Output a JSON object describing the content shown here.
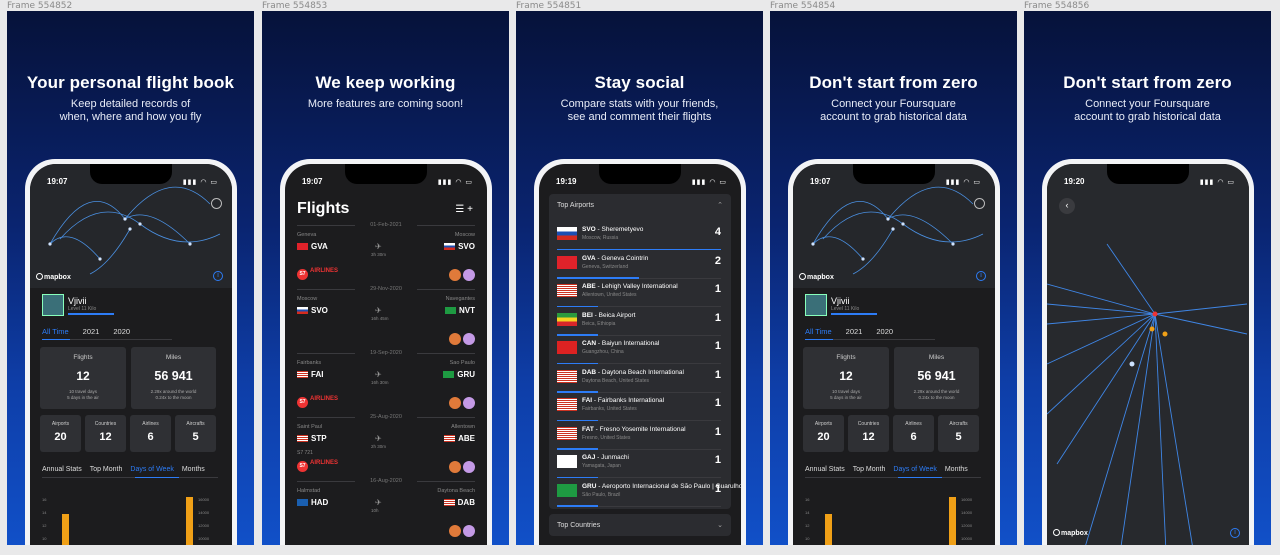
{
  "frames": [
    {
      "label": "Frame 554852",
      "title": "Your personal flight book",
      "subtitle1": "Keep detailed records of",
      "subtitle2": "when, where and how you fly",
      "time": "19:07"
    },
    {
      "label": "Frame 554853",
      "title": "We keep working",
      "subtitle1": "More features are coming soon!",
      "subtitle2": "",
      "time": "19:07"
    },
    {
      "label": "Frame 554851",
      "title": "Stay social",
      "subtitle1": "Compare stats with your friends,",
      "subtitle2": "see and comment their flights",
      "time": "19:19"
    },
    {
      "label": "Frame 554854",
      "title": "Don't start from zero",
      "subtitle1": "Connect your Foursquare",
      "subtitle2": "account to grab historical data",
      "time": "19:07"
    },
    {
      "label": "Frame 554856",
      "title": "Don't start from zero",
      "subtitle1": "Connect your Foursquare",
      "subtitle2": "account to grab historical data",
      "time": "19:20"
    }
  ],
  "mapbox": "mapbox",
  "profile": {
    "name": "Vjivii",
    "level": "Level 11 Kilo",
    "year_tabs": [
      "All Time",
      "2021",
      "2020"
    ],
    "flights_label": "Flights",
    "flights_value": "12",
    "flights_sub1": "10 travel days",
    "flights_sub2": "5 days in the air",
    "miles_label": "Miles",
    "miles_value": "56 941",
    "miles_sub1": "2.29x around the world",
    "miles_sub2": "0.24x to the moon",
    "airports_label": "Airports",
    "airports_value": "20",
    "countries_label": "Countries",
    "countries_value": "12",
    "airlines_label": "Airlines",
    "airlines_value": "6",
    "aircrafts_label": "Aircrafts",
    "aircrafts_value": "5",
    "stat_tabs": [
      "Annual Stats",
      "Top Month",
      "Days of Week",
      "Months"
    ],
    "axis_left": [
      "16",
      "14",
      "12",
      "10"
    ],
    "axis_right": [
      "16000",
      "14000",
      "12000",
      "10000"
    ]
  },
  "flights_screen": {
    "title": "Flights",
    "filter_icon": "filter-icon",
    "add_icon": "plus-icon",
    "dates": [
      "01-Feb-2021",
      "29-Nov-2020",
      "19-Sep-2020",
      "25-Aug-2020",
      "16-Aug-2020"
    ],
    "items": [
      {
        "from_city": "Geneva",
        "from": "GVA",
        "to_city": "Moscow",
        "to": "SVO",
        "duration": "3h 30m",
        "number": "",
        "airline": "AIRLINES"
      },
      {
        "from_city": "Moscow",
        "from": "SVO",
        "to_city": "Navegantes",
        "to": "NVT",
        "duration": "16h 45m",
        "number": "",
        "airline": ""
      },
      {
        "from_city": "Fairbanks",
        "from": "FAI",
        "to_city": "Sao Paulo",
        "to": "GRU",
        "duration": "16h 30m",
        "number": "",
        "airline": "AIRLINES"
      },
      {
        "from_city": "Saint Paul",
        "from": "STP",
        "to_city": "Allentown",
        "to": "ABE",
        "duration": "2h 30m",
        "number": "S7 721",
        "airline": "AIRLINES"
      },
      {
        "from_city": "Halmstad",
        "from": "HAD",
        "to_city": "Daytona Beach",
        "to": "DAB",
        "duration": "10h",
        "number": "",
        "airline": ""
      }
    ]
  },
  "airports_screen": {
    "header": "Top Airports",
    "footer": "Top Countries",
    "rows": [
      {
        "code": "SVO",
        "name": "Sheremetyevo",
        "loc": "Moscow, Russia",
        "count": "4",
        "flag": "f-ru",
        "bar": 100
      },
      {
        "code": "GVA",
        "name": "Geneva Cointrin",
        "loc": "Geneva, Switzerland",
        "count": "2",
        "flag": "f-ch",
        "bar": 50
      },
      {
        "code": "ABE",
        "name": "Lehigh Valley International",
        "loc": "Allentown, United States",
        "count": "1",
        "flag": "f-us",
        "bar": 25
      },
      {
        "code": "BEI",
        "name": "Beica Airport",
        "loc": "Beica, Ethiopia",
        "count": "1",
        "flag": "f-et",
        "bar": 25
      },
      {
        "code": "CAN",
        "name": "Baiyun International",
        "loc": "Guangzhou, China",
        "count": "1",
        "flag": "f-cn",
        "bar": 25
      },
      {
        "code": "DAB",
        "name": "Daytona Beach International",
        "loc": "Daytona Beach, United States",
        "count": "1",
        "flag": "f-us",
        "bar": 25
      },
      {
        "code": "FAI",
        "name": "Fairbanks International",
        "loc": "Fairbanks, United States",
        "count": "1",
        "flag": "f-us",
        "bar": 25
      },
      {
        "code": "FAT",
        "name": "Fresno Yosemite International",
        "loc": "Fresno, United States",
        "count": "1",
        "flag": "f-us",
        "bar": 25
      },
      {
        "code": "GAJ",
        "name": "Junmachi",
        "loc": "Yamagata, Japan",
        "count": "1",
        "flag": "f-jp",
        "bar": 25
      },
      {
        "code": "GRU",
        "name": "Aeroporto Internacional de São Paulo | Guarulhos",
        "loc": "São Paulo, Brazil",
        "count": "1",
        "flag": "f-br",
        "bar": 25
      }
    ]
  },
  "colors": {
    "accent": "#2d7cf6",
    "bar": "#f0a017",
    "bg": "#1c1c1e",
    "airline": "#e33"
  }
}
